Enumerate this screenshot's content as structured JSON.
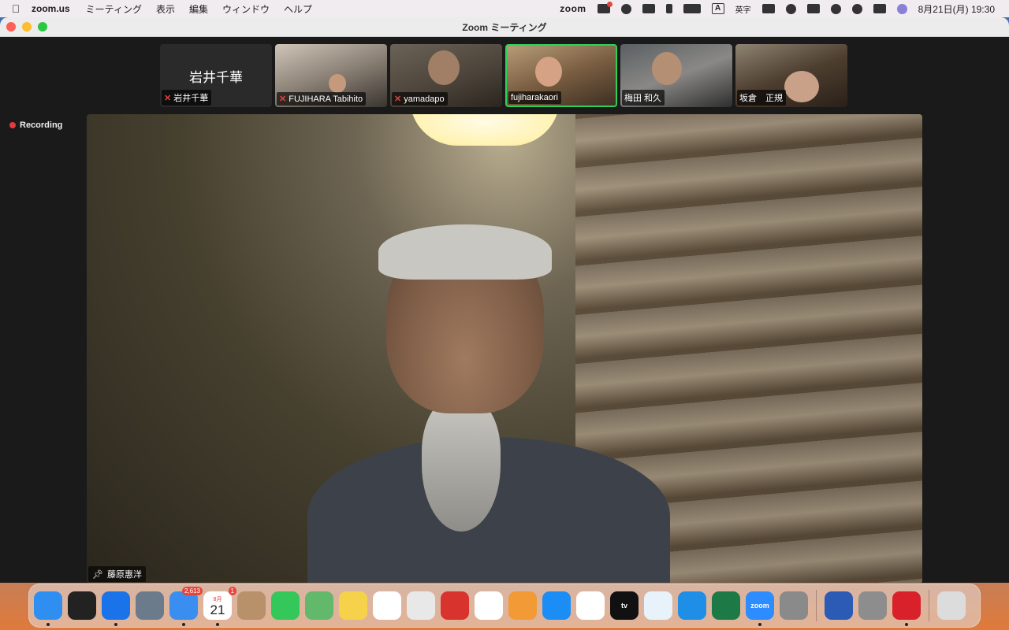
{
  "menubar": {
    "app_name": "zoom.us",
    "menus": [
      "ミーティング",
      "表示",
      "編集",
      "ウィンドウ",
      "ヘルプ"
    ],
    "zoom_label": "zoom",
    "input_method": "英字",
    "input_badge": "A",
    "datetime": "8月21日(月)  19:30"
  },
  "window": {
    "title": "Zoom ミーティング"
  },
  "recording": {
    "label": "Recording"
  },
  "participants": [
    {
      "name": "岩井千華",
      "display_name": "岩井千華",
      "muted": true,
      "video": false
    },
    {
      "name": "FUJIHARA Tabihito",
      "muted": true,
      "video": true
    },
    {
      "name": "yamadapo",
      "muted": true,
      "video": true
    },
    {
      "name": "fujiharakaori",
      "muted": false,
      "video": true,
      "active_speaker": true
    },
    {
      "name": "梅田 和久",
      "muted": false,
      "video": true
    },
    {
      "name": "坂倉　正規",
      "muted": false,
      "video": true
    }
  ],
  "main_speaker": {
    "name": "藤原惠洋",
    "pinned": true
  },
  "dock": {
    "apps": [
      {
        "name": "Finder",
        "icon": "finder-icon",
        "color": "#2f8ff0",
        "running": true
      },
      {
        "name": "Mission Control",
        "icon": "mission-control-icon",
        "color": "#222222",
        "running": false
      },
      {
        "name": "Safari",
        "icon": "safari-icon",
        "color": "#1a73e8",
        "running": true
      },
      {
        "name": "Preview",
        "icon": "preview-icon",
        "color": "#6c7b8c",
        "running": false
      },
      {
        "name": "Mail",
        "icon": "mail-icon",
        "color": "#3a8ef0",
        "running": true,
        "badge": "2,613"
      },
      {
        "name": "Calendar",
        "icon": "calendar-icon",
        "color": "#ffffff",
        "running": true,
        "badge": "1",
        "date_label": "21",
        "month_label": "8月"
      },
      {
        "name": "Contacts",
        "icon": "contacts-icon",
        "color": "#b8906a",
        "running": false
      },
      {
        "name": "Messages",
        "icon": "messages-icon",
        "color": "#34c759",
        "running": false
      },
      {
        "name": "Maps",
        "icon": "maps-icon",
        "color": "#62b86b",
        "running": false
      },
      {
        "name": "Notes",
        "icon": "notes-icon",
        "color": "#f6d24a",
        "running": false
      },
      {
        "name": "Freeform",
        "icon": "freeform-icon",
        "color": "#ffffff",
        "running": false
      },
      {
        "name": "Launchpad",
        "icon": "launchpad-icon",
        "color": "#e8e8e8",
        "running": false
      },
      {
        "name": "Photo Booth",
        "icon": "photo-booth-icon",
        "color": "#d8332c",
        "running": false
      },
      {
        "name": "Photos",
        "icon": "photos-icon",
        "color": "#ffffff",
        "running": false
      },
      {
        "name": "Books",
        "icon": "books-icon",
        "color": "#f19a36",
        "running": false
      },
      {
        "name": "App Store",
        "icon": "app-store-icon",
        "color": "#1c8df5",
        "running": false
      },
      {
        "name": "Reminders",
        "icon": "reminders-icon",
        "color": "#ffffff",
        "running": false
      },
      {
        "name": "TV",
        "icon": "tv-icon",
        "color": "#111111",
        "running": false,
        "text": "tv"
      },
      {
        "name": "Skype",
        "icon": "skype-icon",
        "color": "#e8f2fb",
        "running": false
      },
      {
        "name": "Skype for Business",
        "icon": "skype-business-icon",
        "color": "#1e8ee6",
        "running": false
      },
      {
        "name": "Excel",
        "icon": "excel-icon",
        "color": "#1d7a46",
        "running": false
      },
      {
        "name": "Zoom",
        "icon": "zoom-app-icon",
        "color": "#2d8cff",
        "running": true,
        "text": "zoom"
      },
      {
        "name": "Google Drive",
        "icon": "drive-icon",
        "color": "#8a8a8a",
        "running": false
      },
      {
        "name": "Word",
        "icon": "word-icon",
        "color": "#2b5bb5",
        "running": false
      },
      {
        "name": "System Settings",
        "icon": "settings-icon",
        "color": "#8d8d8d",
        "running": false
      },
      {
        "name": "Trend Micro",
        "icon": "trend-micro-icon",
        "color": "#d8212a",
        "running": true
      },
      {
        "name": "Trash",
        "icon": "trash-icon",
        "color": "#dcdcdc",
        "running": false
      }
    ]
  }
}
